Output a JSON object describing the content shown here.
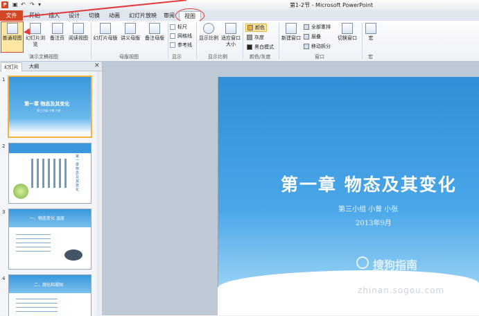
{
  "window": {
    "app_icon": "P",
    "qat": [
      "↶",
      "↷",
      "▾"
    ],
    "title": "第1-2节 - Microsoft PowerPoint"
  },
  "tabs": [
    {
      "label": "文件",
      "active": false
    },
    {
      "label": "开始"
    },
    {
      "label": "插入"
    },
    {
      "label": "设计"
    },
    {
      "label": "切换"
    },
    {
      "label": "动画"
    },
    {
      "label": "幻灯片放映"
    },
    {
      "label": "审阅"
    },
    {
      "label": "视图",
      "active": true
    }
  ],
  "ribbon": {
    "presentation_views": {
      "label": "演示文稿视图",
      "buttons": [
        "普通视图",
        "幻灯片浏览",
        "备注页",
        "阅读视图"
      ]
    },
    "master_views": {
      "label": "母版视图",
      "buttons": [
        "幻灯片母版",
        "讲义母版",
        "备注母版"
      ]
    },
    "show": {
      "label": "显示",
      "checks": [
        "标尺",
        "网格线",
        "参考线"
      ]
    },
    "zoom": {
      "label": "显示比例",
      "buttons": [
        "显示比例",
        "适应窗口大小"
      ]
    },
    "color": {
      "label": "颜色/灰度",
      "buttons": [
        "颜色",
        "灰度",
        "黑白模式"
      ]
    },
    "window": {
      "label": "窗口",
      "new_window": "新建窗口",
      "items": [
        "全部重排",
        "层叠",
        "移动拆分"
      ],
      "switch": "切换窗口"
    },
    "macros": {
      "label": "宏",
      "button": "宏"
    }
  },
  "panel": {
    "tab_slides": "幻灯片",
    "tab_outline": "大纲",
    "close": "✕",
    "slides": [
      {
        "num": "1",
        "title": "第一章 物态及其变化",
        "sub": "第三小组 小曾 小张"
      },
      {
        "num": "2",
        "title": "第一章 物态及其变化"
      },
      {
        "num": "3",
        "title": "一、物态变化 温度"
      },
      {
        "num": "4",
        "title": "二、熔化和凝固"
      }
    ]
  },
  "slide": {
    "title": "第一章 物态及其变化",
    "subtitle1": "第三小组 小曾 小张",
    "subtitle2": "2013年9月"
  },
  "watermark": {
    "text": "搜狗指南",
    "url": "zhinan.sogou.com"
  },
  "colors": {
    "file_tab": "#d24726",
    "annotation": "#e23a3a",
    "slide_blue": "#2f8fd8"
  }
}
